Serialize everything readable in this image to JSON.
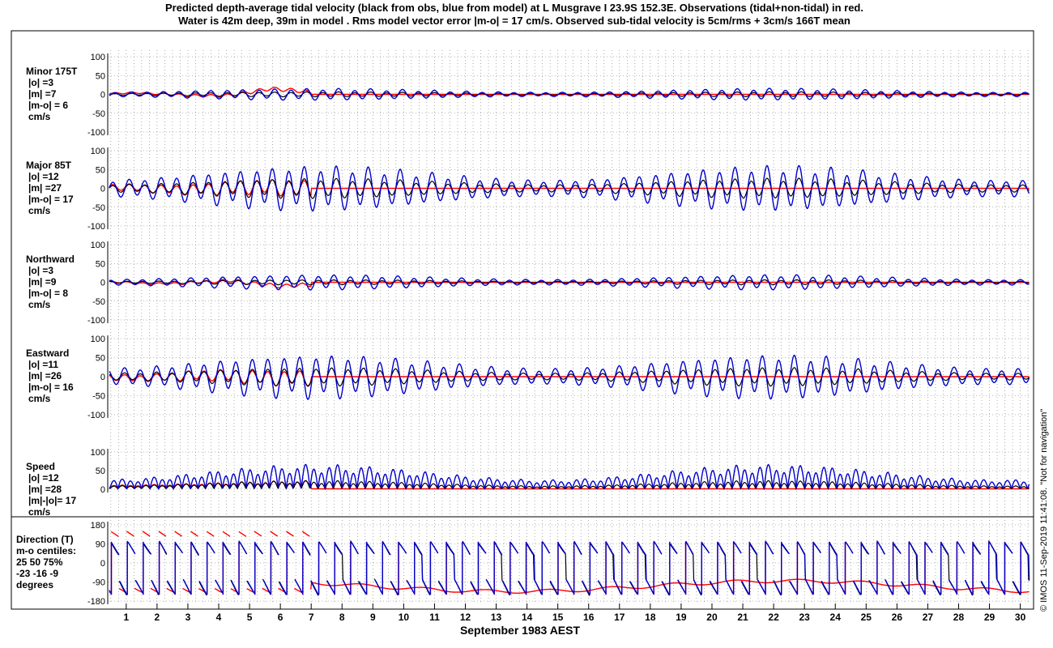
{
  "title_line1": "Predicted depth-average tidal velocity (black from obs, blue from model) at L Musgrave I 23.9S 152.3E. Observations (tidal+non-tidal) in red.",
  "title_line2": "Water is 42m deep, 39m in model . Rms model vector error |m-o| = 17 cm/s. Observed sub-tidal velocity is 5cm/rms + 3cm/s 166T mean",
  "credit": "© IMOS 11-Sep-2019 11:41:08. \"Not for navigation\"",
  "colors": {
    "observed": "#ff0000",
    "predicted_obs": "#000000",
    "predicted_model": "#0000cc"
  },
  "chart_data": {
    "type": "line",
    "xlabel": "September 1983 AEST",
    "x_ticks": [
      "1",
      "2",
      "3",
      "4",
      "5",
      "6",
      "7",
      "8",
      "9",
      "10",
      "11",
      "12",
      "13",
      "14",
      "15",
      "16",
      "17",
      "18",
      "19",
      "20",
      "21",
      "22",
      "23",
      "24",
      "25",
      "26",
      "27",
      "28",
      "29",
      "30"
    ],
    "xlim": [
      0.4,
      30.3
    ],
    "grid": true,
    "series_names": [
      "Observations (tidal+non-tidal)",
      "Predicted from obs",
      "Predicted from model"
    ],
    "panels": [
      {
        "id": "minor",
        "label_lines": [
          "Minor 175T",
          "|o| =3",
          "|m| =7",
          "|m-o| = 6",
          "cm/s"
        ],
        "ylim": [
          -100,
          100
        ],
        "yticks": [
          "100",
          "50",
          "0",
          "-50",
          "-100"
        ],
        "obs_amp": 3,
        "model_amp": 7,
        "obs_end_day": 7
      },
      {
        "id": "major",
        "label_lines": [
          "Major 85T",
          "|o| =12",
          "|m| =27",
          "|m-o| = 17",
          "cm/s"
        ],
        "ylim": [
          -100,
          100
        ],
        "yticks": [
          "100",
          "50",
          "0",
          "-50",
          "-100"
        ],
        "obs_amp": 12,
        "model_amp": 27,
        "obs_end_day": 7
      },
      {
        "id": "northward",
        "label_lines": [
          "Northward",
          "|o| =3",
          "|m| =9",
          "|m-o| = 8",
          "cm/s"
        ],
        "ylim": [
          -100,
          100
        ],
        "yticks": [
          "100",
          "50",
          "0",
          "-50",
          "-100"
        ],
        "obs_amp": 3,
        "model_amp": 9,
        "obs_end_day": 7
      },
      {
        "id": "eastward",
        "label_lines": [
          "Eastward",
          "|o| =11",
          "|m| =26",
          "|m-o| = 16",
          "cm/s"
        ],
        "ylim": [
          -100,
          100
        ],
        "yticks": [
          "100",
          "50",
          "0",
          "-50",
          "-100"
        ],
        "obs_amp": 11,
        "model_amp": 26,
        "obs_end_day": 7
      },
      {
        "id": "speed",
        "label_lines": [
          "Speed",
          "|o| =12",
          "|m| =28",
          "|m|-|o|= 17",
          "cm/s"
        ],
        "ylim": [
          0,
          100
        ],
        "yticks": [
          "100",
          "50",
          "0"
        ],
        "obs_amp": 12,
        "model_amp": 28,
        "obs_end_day": 7
      },
      {
        "id": "direction",
        "label_lines": [
          "Direction (T)",
          "m-o centiles:",
          "25  50  75%",
          "-23  -16   -9",
          "degrees"
        ],
        "ylim": [
          -180,
          180
        ],
        "yticks": [
          "180",
          "90",
          "0",
          "-90",
          "-180"
        ]
      }
    ]
  }
}
